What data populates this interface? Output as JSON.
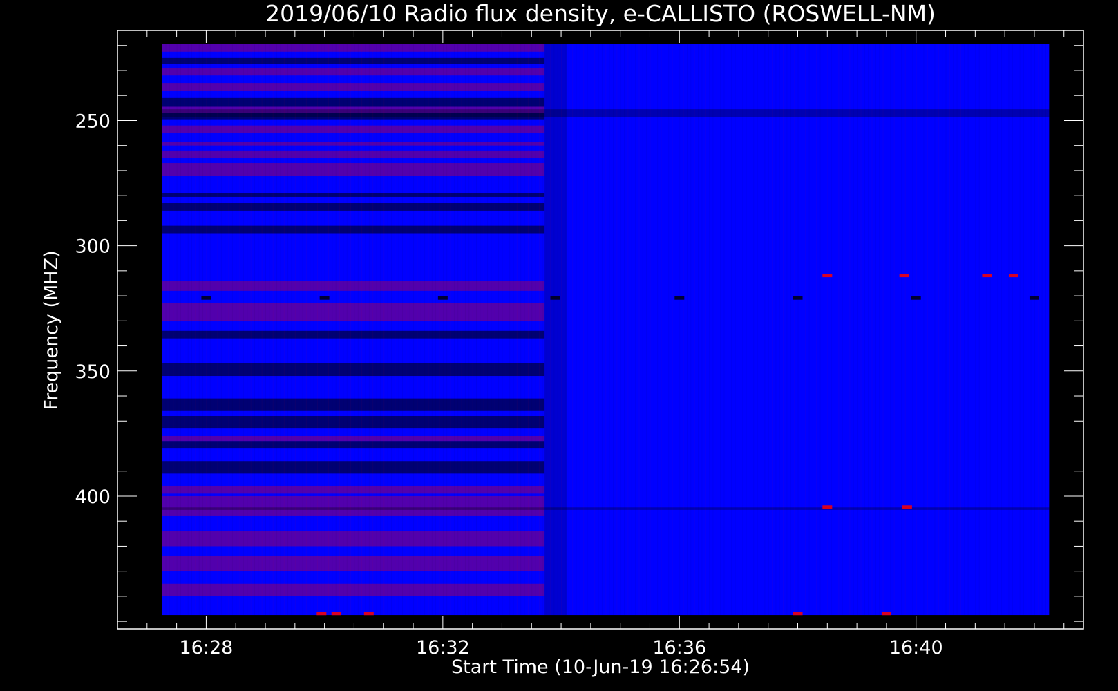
{
  "chart_data": {
    "type": "heatmap",
    "title": "2019/06/10  Radio flux density, e-CALLISTO (ROSWELL-NM)",
    "xlabel": "Start Time (10-Jun-19 16:26:54)",
    "ylabel": "Frequency (MHZ)",
    "x_axis": {
      "ticks_minutes": [
        28,
        32,
        36,
        40
      ],
      "tick_labels": [
        "16:28",
        "16:32",
        "16:36",
        "16:40"
      ],
      "range_minutes": [
        26.5,
        42.83
      ],
      "data_range_minutes": [
        27.25,
        42.25
      ]
    },
    "y_axis": {
      "inverted": true,
      "ticks": [
        250,
        300,
        350,
        400
      ],
      "tick_labels": [
        "250",
        "300",
        "350",
        "400"
      ],
      "range_mhz": [
        214,
        453
      ],
      "data_range_mhz": [
        219.5,
        447.5
      ]
    },
    "colors": {
      "background": "#0000ff",
      "strong": "#ff0000",
      "weak": "#000000",
      "frame": "#ffffff"
    },
    "first_segment_end_minutes": 33.72,
    "transition_end_minutes": 34.1,
    "bands_first_segment": [
      {
        "from": 219.5,
        "to": 222.5,
        "level": "strong"
      },
      {
        "from": 225,
        "to": 227.5,
        "level": "weak"
      },
      {
        "from": 229,
        "to": 232,
        "level": "strong"
      },
      {
        "from": 235,
        "to": 238,
        "level": "strong"
      },
      {
        "from": 241,
        "to": 244.5,
        "level": "weak"
      },
      {
        "from": 244.5,
        "to": 247,
        "level": "strong"
      },
      {
        "from": 247,
        "to": 249.5,
        "level": "weak"
      },
      {
        "from": 252,
        "to": 255,
        "level": "strong"
      },
      {
        "from": 258.5,
        "to": 260,
        "level": "strong"
      },
      {
        "from": 262,
        "to": 265,
        "level": "strong"
      },
      {
        "from": 267,
        "to": 272,
        "level": "strong"
      },
      {
        "from": 279,
        "to": 280.5,
        "level": "weak"
      },
      {
        "from": 283,
        "to": 286,
        "level": "weak"
      },
      {
        "from": 292,
        "to": 295,
        "level": "weak"
      },
      {
        "from": 314,
        "to": 318,
        "level": "strong"
      },
      {
        "from": 323,
        "to": 330,
        "level": "strong"
      },
      {
        "from": 334,
        "to": 337,
        "level": "weak"
      },
      {
        "from": 347,
        "to": 352,
        "level": "weak"
      },
      {
        "from": 361,
        "to": 366,
        "level": "weak"
      },
      {
        "from": 368,
        "to": 373,
        "level": "weak"
      },
      {
        "from": 376,
        "to": 378,
        "level": "strong"
      },
      {
        "from": 378,
        "to": 381,
        "level": "weak"
      },
      {
        "from": 386,
        "to": 391,
        "level": "weak"
      },
      {
        "from": 396,
        "to": 399,
        "level": "strong"
      },
      {
        "from": 400,
        "to": 408,
        "level": "strong"
      },
      {
        "from": 414,
        "to": 420,
        "level": "strong"
      },
      {
        "from": 424,
        "to": 430,
        "level": "strong"
      },
      {
        "from": 435,
        "to": 440,
        "level": "strong"
      }
    ],
    "bands_full": [
      {
        "from": 245.5,
        "to": 248.5,
        "level": "weak"
      },
      {
        "from": 404.5,
        "to": 405.5,
        "level": "weak"
      }
    ],
    "spots": [
      {
        "t": 28.0,
        "f": 321,
        "level": "weak"
      },
      {
        "t": 30.0,
        "f": 321,
        "level": "weak"
      },
      {
        "t": 32.0,
        "f": 321,
        "level": "weak"
      },
      {
        "t": 33.9,
        "f": 321,
        "level": "weak"
      },
      {
        "t": 36.0,
        "f": 321,
        "level": "weak"
      },
      {
        "t": 38.0,
        "f": 321,
        "level": "weak"
      },
      {
        "t": 40.0,
        "f": 321,
        "level": "weak"
      },
      {
        "t": 42.0,
        "f": 321,
        "level": "weak"
      },
      {
        "t": 38.5,
        "f": 312,
        "level": "strong"
      },
      {
        "t": 39.8,
        "f": 312,
        "level": "strong"
      },
      {
        "t": 41.2,
        "f": 312,
        "level": "strong"
      },
      {
        "t": 41.65,
        "f": 312,
        "level": "strong"
      },
      {
        "t": 38.5,
        "f": 404.5,
        "level": "strong"
      },
      {
        "t": 39.85,
        "f": 404.5,
        "level": "strong"
      },
      {
        "t": 29.95,
        "f": 447,
        "level": "strong"
      },
      {
        "t": 30.2,
        "f": 447,
        "level": "strong"
      },
      {
        "t": 30.75,
        "f": 447,
        "level": "strong"
      },
      {
        "t": 38.0,
        "f": 447,
        "level": "strong"
      },
      {
        "t": 39.5,
        "f": 447,
        "level": "strong"
      }
    ]
  }
}
